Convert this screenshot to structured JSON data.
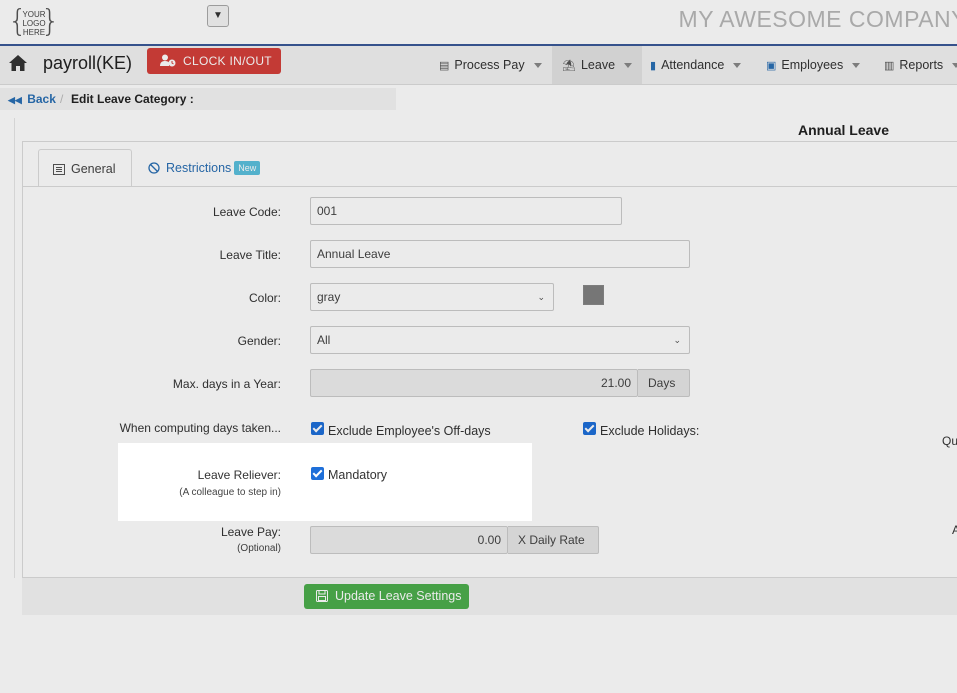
{
  "logo": {
    "line1": "YOUR",
    "line2": "LOGO",
    "line3": "HERE"
  },
  "company_name": "MY AWESOME COMPANY",
  "app_title": "payroll(KE)",
  "clock_button": "CLOCK IN/OUT",
  "nav": {
    "items": [
      {
        "label": "Process Pay",
        "icon": "table-icon"
      },
      {
        "label": "Leave",
        "icon": "beach-icon"
      },
      {
        "label": "Attendance",
        "icon": "badge-icon"
      },
      {
        "label": "Employees",
        "icon": "users-icon"
      },
      {
        "label": "Reports",
        "icon": "chart-icon"
      }
    ]
  },
  "breadcrumb": {
    "back": "Back",
    "current": "Edit Leave Category :"
  },
  "panel_title": "Annual Leave",
  "tabs": {
    "general": "General",
    "restrictions": "Restrictions",
    "new_badge": "New"
  },
  "form": {
    "leave_code": {
      "label": "Leave Code:",
      "value": "001"
    },
    "leave_title": {
      "label": "Leave Title:",
      "value": "Annual Leave"
    },
    "color": {
      "label": "Color:",
      "value": "gray",
      "swatch": "#808080"
    },
    "gender": {
      "label": "Gender:",
      "value": "All"
    },
    "max_days": {
      "label": "Max. days in a Year:",
      "value": "21.00",
      "unit": "Days"
    },
    "computing": {
      "label": "When computing days taken...",
      "exclude_offdays": "Exclude Employee's Off-days",
      "exclude_holidays": "Exclude Holidays:"
    },
    "reliever": {
      "label": "Leave Reliever:",
      "sub": "(A colleague to step in)",
      "checkbox": "Mandatory"
    },
    "leave_pay": {
      "label": "Leave Pay:",
      "sub": "(Optional)",
      "value": "0.00",
      "unit": "X Daily Rate"
    },
    "cut_right_1": "Qu",
    "cut_right_2": "A"
  },
  "update_button": "Update Leave Settings"
}
